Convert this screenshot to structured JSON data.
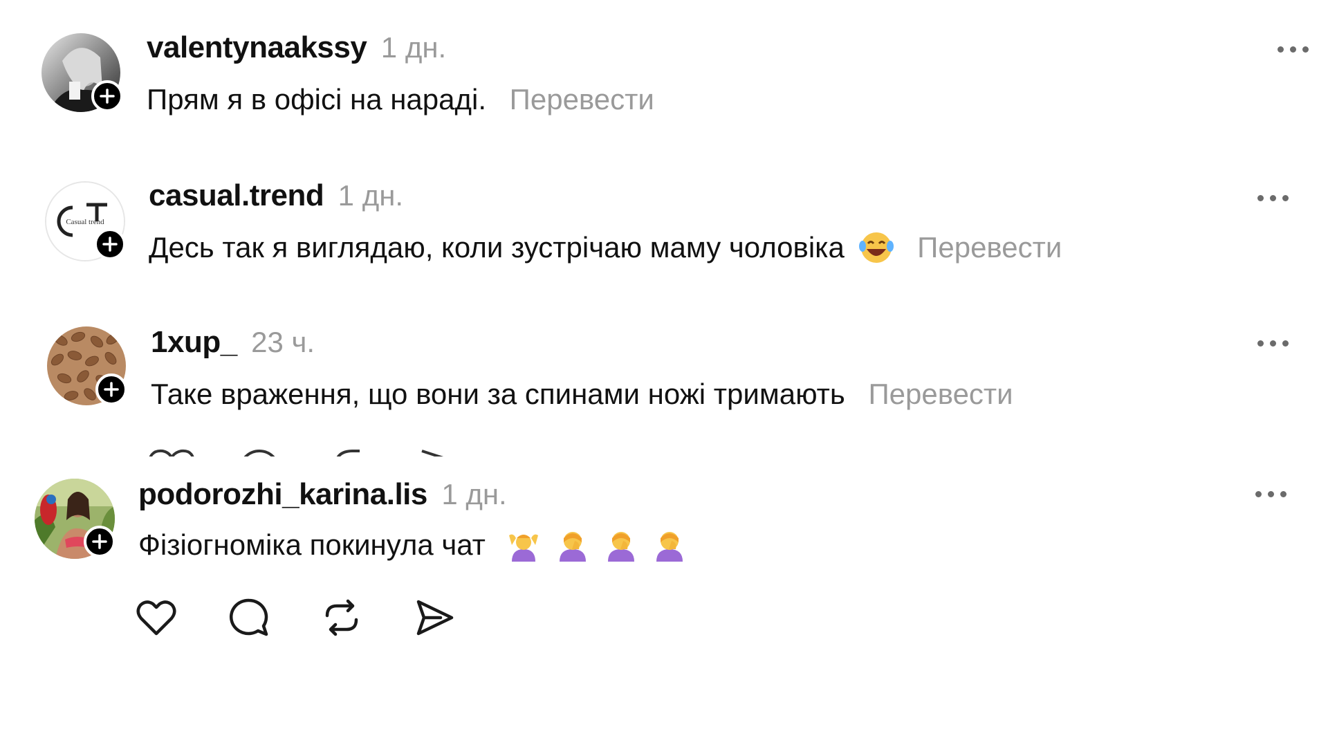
{
  "comments": [
    {
      "username": "valentynaakssy",
      "time": "1 дн.",
      "text": "Прям я в офісі на нараді.",
      "translate": "Перевести"
    },
    {
      "username": "casual.trend",
      "time": "1 дн.",
      "text": "Десь так я виглядаю, коли зустрічаю маму чоловіка",
      "translate": "Перевести",
      "avatar_logo": "Casual trend",
      "emoji": "laughing-emoji"
    },
    {
      "username": "1xup_",
      "time": "23 ч.",
      "text": "Таке враження, що вони за спинами ножі тримають",
      "translate": "Перевести"
    },
    {
      "username": "podorozhi_karina.lis",
      "time": "1 дн.",
      "text": "Фізіогноміка покинула чат",
      "emojis": [
        "shrug-emoji",
        "facepalm-emoji",
        "facepalm-emoji",
        "facepalm-emoji"
      ]
    }
  ],
  "actions": [
    "like-icon",
    "comment-icon",
    "repost-icon",
    "share-icon"
  ],
  "colors": {
    "text": "#111111",
    "muted": "#9a9a9a",
    "badge": "#000000"
  }
}
